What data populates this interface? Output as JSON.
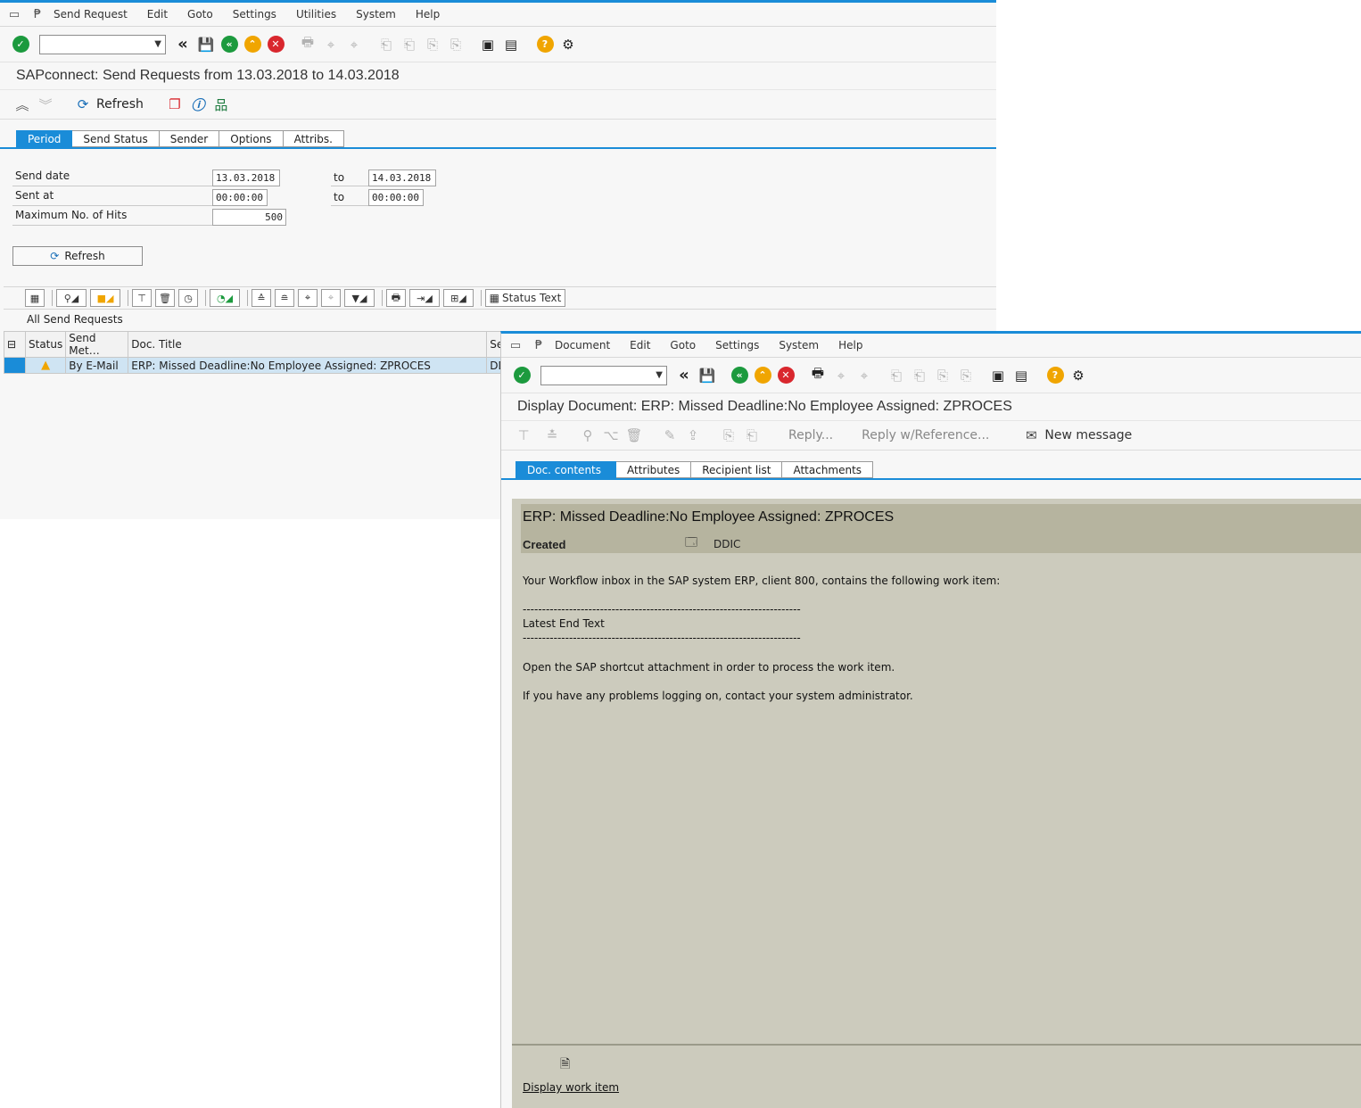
{
  "window1": {
    "menu": [
      "Send Request",
      "Edit",
      "Goto",
      "Settings",
      "Utilities",
      "System",
      "Help"
    ],
    "title": "SAPconnect: Send Requests from 13.03.2018 to 14.03.2018",
    "apptoolbar": {
      "refresh": "Refresh"
    },
    "tabs": [
      "Period",
      "Send Status",
      "Sender",
      "Options",
      "Attribs."
    ],
    "form": {
      "send_date_label": "Send date",
      "send_date_from": "13.03.2018",
      "to1": "to",
      "send_date_to": "14.03.2018",
      "sent_at_label": "Sent at",
      "sent_at_from": "00:00:00",
      "to2": "to",
      "sent_at_to": "00:00:00",
      "max_hits_label": "Maximum No. of Hits",
      "max_hits": "500",
      "refresh_button": "Refresh"
    },
    "grid": {
      "status_text_button": "Status Text",
      "title": "All Send Requests",
      "columns": [
        "Status",
        "Send Met…",
        "Doc. Title",
        "Ser"
      ],
      "rows": [
        {
          "send_method": "By E-Mail",
          "doc_title": "ERP: Missed Deadline:No Employee Assigned: ZPROCES",
          "sender": "DD"
        }
      ]
    }
  },
  "window2": {
    "menu": [
      "Document",
      "Edit",
      "Goto",
      "Settings",
      "System",
      "Help"
    ],
    "title": "Display Document: ERP: Missed Deadline:No Employee Assigned: ZPROCES",
    "apptoolbar": {
      "reply": "Reply...",
      "reply_ref": "Reply w/Reference...",
      "new_message": "New message"
    },
    "tabs": [
      "Doc. contents",
      "Attributes",
      "Recipient list",
      "Attachments"
    ],
    "document": {
      "title": "ERP: Missed Deadline:No Employee Assigned: ZPROCES",
      "created_label": "Created",
      "created_by": "DDIC",
      "line1": "Your Workflow inbox in the SAP system ERP, client 800, contains the following work item:",
      "dashes1": "------------------------------------------------------------------------",
      "line2": "Latest End Text",
      "dashes2": "------------------------------------------------------------------------",
      "line3": "Open the SAP shortcut attachment in order to process the work item.",
      "line4": "If you have any problems logging on, contact your system administrator."
    },
    "footer_link": "Display work item"
  },
  "colors": {
    "accent": "#1a8cd8",
    "doc_bg": "#cccbbd",
    "doc_header": "#b6b49f",
    "ok_green": "#1c9a3e",
    "nav_orange": "#f0a500",
    "cancel_red": "#d9272e"
  }
}
